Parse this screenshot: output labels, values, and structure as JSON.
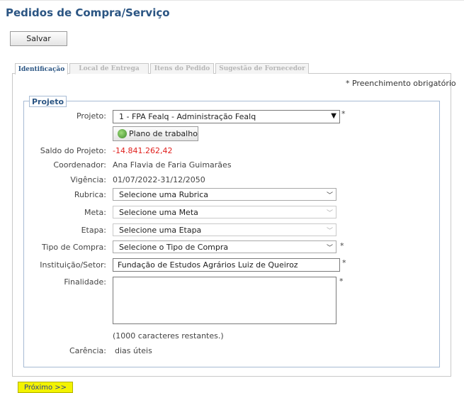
{
  "page": {
    "title": "Pedidos de Compra/Serviço"
  },
  "toolbar": {
    "save_label": "Salvar"
  },
  "tabs": [
    {
      "label": "Identificação",
      "active": true
    },
    {
      "label": "Local de Entrega",
      "active": false
    },
    {
      "label": "Itens do Pedido",
      "active": false
    },
    {
      "label": "Sugestão de Fornecedor",
      "active": false
    }
  ],
  "required_note": "* Preenchimento obrigatório",
  "section": {
    "legend": "Projeto"
  },
  "form": {
    "projeto": {
      "label": "Projeto:",
      "value": "1 - FPA Fealq - Administração Fealq",
      "required_mark": "*",
      "toggle_icon": "triangle-down-icon"
    },
    "plano_button": {
      "label": "Plano de trabalho",
      "icon": "plano-icon"
    },
    "saldo": {
      "label": "Saldo do Projeto:",
      "value": "-14.841.262,42",
      "color": "#e0201d"
    },
    "coordenador": {
      "label": "Coordenador:",
      "value": "Ana Flavia de Faria Guimarães"
    },
    "vigencia": {
      "label": "Vigência:",
      "value": "01/07/2022-31/12/2050"
    },
    "rubrica": {
      "label": "Rubrica:",
      "value": "Selecione uma Rubrica"
    },
    "meta": {
      "label": "Meta:",
      "value": "Selecione uma Meta"
    },
    "etapa": {
      "label": "Etapa:",
      "value": "Selecione uma Etapa"
    },
    "tipo_compra": {
      "label": "Tipo de Compra:",
      "value": "Selecione o Tipo de Compra",
      "required_mark": "*"
    },
    "instituicao": {
      "label": "Instituição/Setor:",
      "value": "Fundação de Estudos Agrários Luiz de Queiroz",
      "required_mark": "*"
    },
    "finalidade": {
      "label": "Finalidade:",
      "value": "",
      "required_mark": "*",
      "remaining": "(1000 caracteres restantes.)"
    },
    "carencia": {
      "label": "Carência:",
      "value": "dias úteis"
    }
  },
  "footer": {
    "next_label": "Próximo >>"
  },
  "colors": {
    "title": "#2b5583",
    "next_button": "#f3f300"
  }
}
